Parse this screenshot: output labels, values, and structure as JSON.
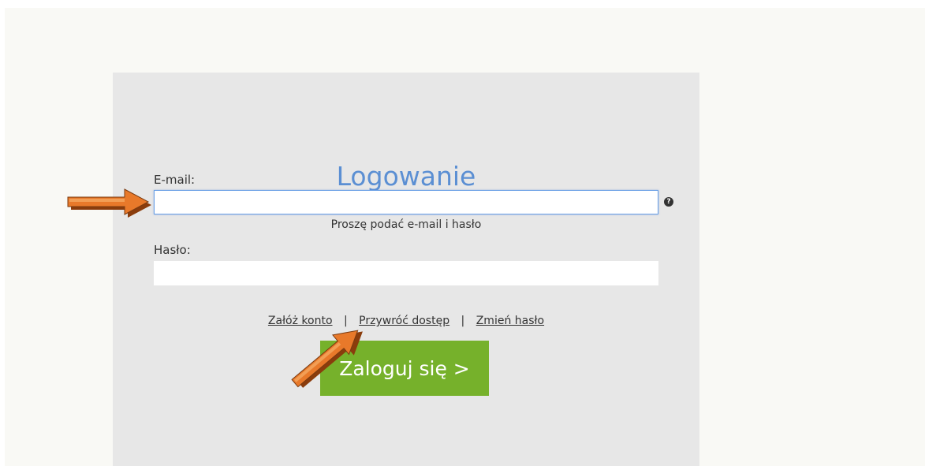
{
  "login": {
    "title": "Logowanie",
    "subtitle": "Proszę podać e-mail i hasło",
    "email_label": "E-mail:",
    "email_value": "",
    "help_icon_glyph": "?",
    "password_label": "Hasło:",
    "password_value": "",
    "links": {
      "create_account": "Załóż konto",
      "separator": "|",
      "restore_access": "Przywróć dostęp",
      "change_password": "Zmień hasło"
    },
    "submit_label": "Zaloguj się >"
  },
  "colors": {
    "title": "#5b8fd3",
    "panel_bg": "#e7e7e7",
    "page_bg": "#f9f9f5",
    "button_bg": "#76b12b",
    "arrow": "#e8792a"
  },
  "icons": {
    "help": "question-circle-icon",
    "annotation_arrows": [
      "arrow-annotation-email",
      "arrow-annotation-restore-access"
    ]
  }
}
